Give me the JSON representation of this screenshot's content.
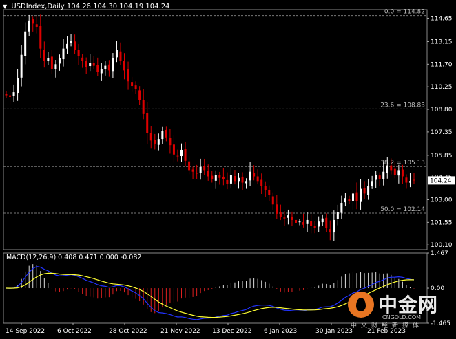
{
  "header": {
    "symbol": "USDIndex,Daily",
    "ohlc": "104.26 104.30 104.19 104.24"
  },
  "macd_header": "MACD(12,26,9) 0.408 0.471 0.000 -0.082",
  "current_price": "104.24",
  "watermark": {
    "brand": "中金网",
    "url": "CNGOLD.COM",
    "sub": "中文财经新媒体"
  },
  "colors": {
    "background": "#000000",
    "bull": "#ffffff",
    "bear": "#dd0000",
    "macd_line": "#2233ff",
    "signal_line": "#ffff33",
    "fib_line": "#777777",
    "axis_text": "#ffffff"
  },
  "chart_data": {
    "type": "candlestick",
    "price_axis": {
      "range": [
        99.8,
        115.2
      ],
      "ticks": [
        "114.65",
        "113.15",
        "111.70",
        "110.25",
        "108.80",
        "107.35",
        "105.85",
        "104.45",
        "103.00",
        "101.55",
        "100.10"
      ]
    },
    "fib_levels": [
      {
        "label": "0.0 = 114.82",
        "value": 114.82
      },
      {
        "label": "23.6 = 108.83",
        "value": 108.83
      },
      {
        "label": "38.2 = 105.13",
        "value": 105.13
      },
      {
        "label": "50.0 = 102.14",
        "value": 102.14
      }
    ],
    "x_labels": [
      "14 Sep 2022",
      "6 Oct 2022",
      "28 Oct 2022",
      "21 Nov 2022",
      "13 Dec 2022",
      "6 Jan 2023",
      "30 Jan 2023",
      "21 Feb 2023"
    ],
    "closes": [
      109.7,
      109.6,
      109.9,
      110.8,
      112.3,
      113.8,
      114.5,
      114.3,
      114.1,
      112.7,
      111.9,
      112.1,
      111.4,
      111.7,
      112.1,
      112.7,
      113.0,
      113.2,
      112.6,
      112.2,
      111.9,
      111.5,
      111.8,
      111.6,
      111.2,
      111.4,
      111.6,
      111.3,
      112.1,
      112.6,
      111.9,
      111.3,
      110.6,
      110.3,
      110.1,
      109.4,
      108.5,
      107.3,
      106.8,
      106.6,
      106.9,
      107.4,
      107.0,
      106.5,
      105.9,
      105.8,
      106.2,
      105.5,
      104.9,
      104.8,
      104.7,
      105.1,
      104.9,
      104.5,
      104.3,
      104.6,
      104.4,
      104.3,
      104.0,
      104.6,
      104.2,
      104.4,
      104.1,
      104.2,
      104.8,
      104.5,
      104.2,
      103.9,
      103.6,
      103.3,
      102.7,
      102.1,
      101.9,
      101.8,
      102.0,
      101.7,
      101.5,
      101.6,
      101.4,
      101.7,
      101.3,
      101.2,
      101.6,
      101.8,
      101.2,
      100.9,
      101.7,
      102.2,
      102.8,
      103.1,
      102.9,
      103.4,
      102.9,
      103.7,
      103.4,
      103.9,
      104.2,
      104.6,
      104.3,
      104.8,
      105.2,
      104.9,
      104.6,
      104.9,
      104.5,
      104.1,
      104.2,
      104.24
    ],
    "macd_axis": {
      "range": [
        -1.465,
        1.467
      ],
      "ticks": [
        "1.467",
        "0.00",
        "-1.465"
      ]
    },
    "macd_values": {
      "main": 0.408,
      "signal": 0.471,
      "histogram_last": 0.0,
      "value": -0.082
    }
  }
}
